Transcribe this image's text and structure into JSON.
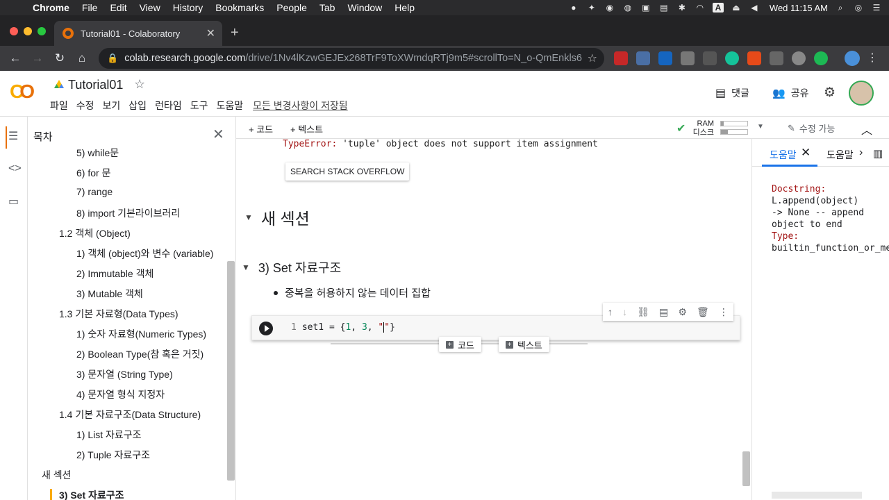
{
  "macos": {
    "app_name": "Chrome",
    "menu": [
      "File",
      "Edit",
      "View",
      "History",
      "Bookmarks",
      "People",
      "Tab",
      "Window",
      "Help"
    ],
    "clock": "Wed 11:15 AM",
    "input_source": "A"
  },
  "browser": {
    "tab_title": "Tutorial01 - Colaboratory",
    "url_host": "colab.research.google.com",
    "url_path": "/drive/1Nv4lKzwGEJEx268TrF9ToXWmdqRTj9m5#scrollTo=N_o-QmEnkls6"
  },
  "colab": {
    "notebook_title": "Tutorial01",
    "menus": [
      "파일",
      "수정",
      "보기",
      "삽입",
      "런타임",
      "도구",
      "도움말"
    ],
    "save_status": "모든 변경사항이 저장됨",
    "comment_label": "댓글",
    "share_label": "공유"
  },
  "toolbar": {
    "add_code": "+ 코드",
    "add_text": "+ 텍스트",
    "ram_label": "RAM",
    "disk_label": "디스크",
    "ram_usage": 0.1,
    "disk_usage": 0.25,
    "editable_label": "수정 가능"
  },
  "toc": {
    "title": "목차",
    "items": [
      {
        "label": "5) while문",
        "level": 2
      },
      {
        "label": "6) for 문",
        "level": 2
      },
      {
        "label": "7) range",
        "level": 2
      },
      {
        "label": "8) import 기본라이브러리",
        "level": 2
      },
      {
        "label": "1.2 객체 (Object)",
        "level": 1
      },
      {
        "label": "1) 객체 (object)와 변수 (variable)",
        "level": 2
      },
      {
        "label": "2) Immutable 객체",
        "level": 2
      },
      {
        "label": "3) Mutable 객체",
        "level": 2
      },
      {
        "label": "1.3 기본 자료형(Data Types)",
        "level": 1
      },
      {
        "label": "1) 숫자 자료형(Numeric Types)",
        "level": 2
      },
      {
        "label": "2) Boolean Type(참 혹은 거짓)",
        "level": 2
      },
      {
        "label": "3) 문자열 (String Type)",
        "level": 2
      },
      {
        "label": "4) 문자열 형식 지정자",
        "level": 2
      },
      {
        "label": "1.4 기본 자료구조(Data Structure)",
        "level": 1
      },
      {
        "label": "1) List 자료구조",
        "level": 2
      },
      {
        "label": "2) Tuple 자료구조",
        "level": 2
      },
      {
        "label": "새 섹션",
        "level": 0
      },
      {
        "label": "3) Set 자료구조",
        "level": 1
      }
    ]
  },
  "notebook": {
    "error_type": "TypeError:",
    "error_msg": " 'tuple' object does not support item assignment",
    "stackoverflow_btn": "SEARCH STACK OVERFLOW",
    "section_title": "새 섹션",
    "subsection_title": "3) Set 자료구조",
    "bullet_text": "중복을 허용하지 않는 데이터 집합",
    "code_line_no": "1",
    "code_prefix": "set1 = {",
    "code_n1": "1",
    "code_sep1": ", ",
    "code_n2": "3",
    "code_sep2": ", ",
    "code_q1": "\"",
    "code_q2": "\"",
    "code_suffix": "}",
    "add_code_btn": "코드",
    "add_text_btn": "텍스트"
  },
  "help": {
    "tab1": "도움말",
    "tab2": "도움말",
    "doc_label": "Docstring:",
    "doc_line1": "L.append(object)",
    "doc_line2": "-> None -- append",
    "doc_line3": "object to end",
    "type_label": "Type:",
    "type_value": "builtin_function_or_method"
  }
}
